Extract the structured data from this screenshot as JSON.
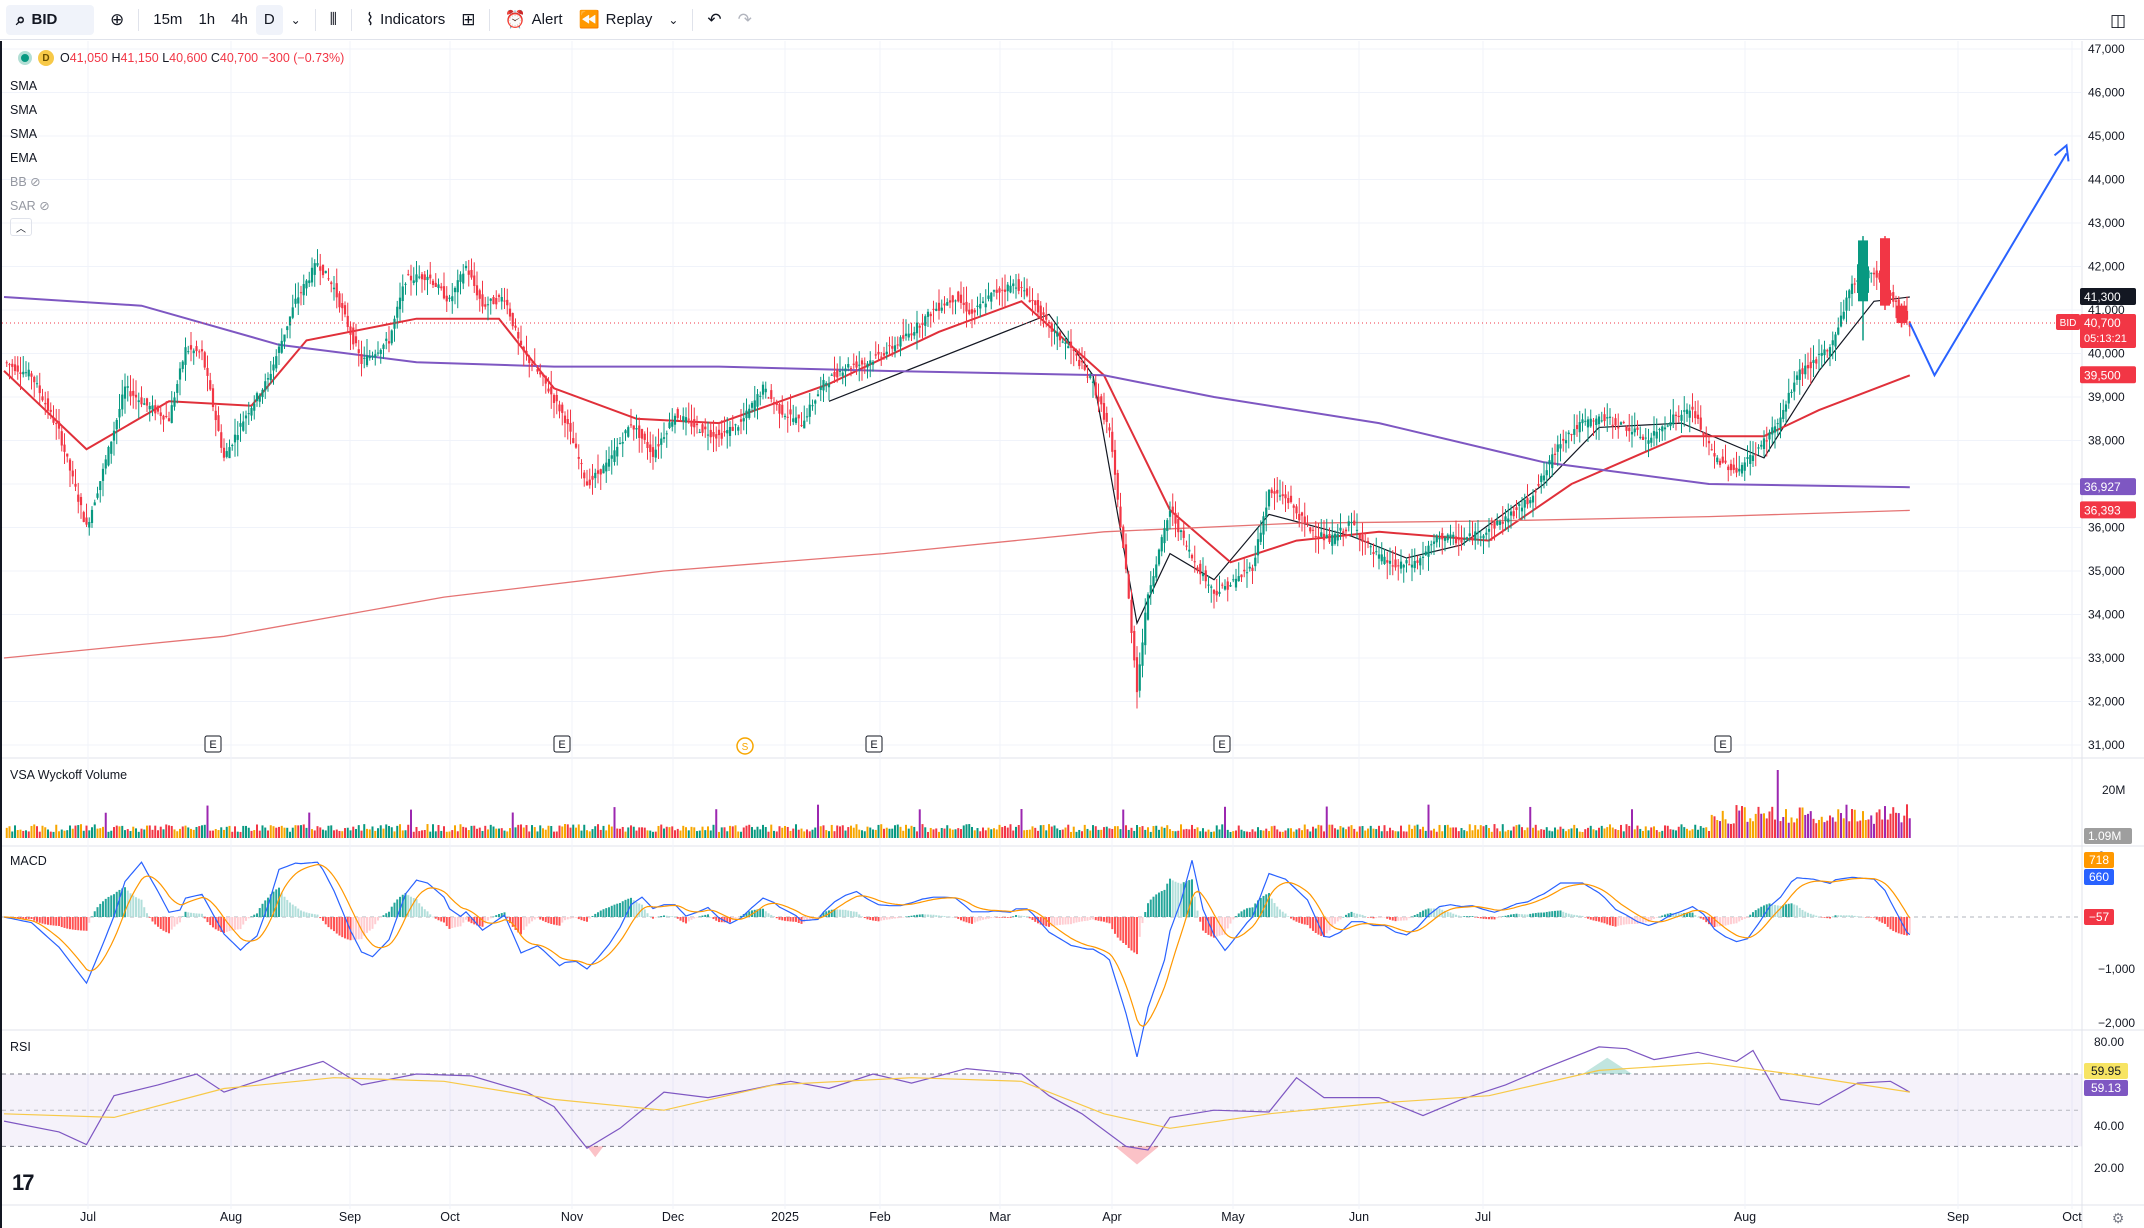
{
  "toolbar": {
    "symbol": "BID",
    "intervals": [
      "15m",
      "1h",
      "4h",
      "D"
    ],
    "active_interval": "D",
    "indicators_label": "Indicators",
    "alert_label": "Alert",
    "replay_label": "Replay"
  },
  "legend": {
    "interval_badge": "D",
    "o_label": "O",
    "o": "41,050",
    "h_label": "H",
    "h": "41,150",
    "l_label": "L",
    "l": "40,600",
    "c_label": "C",
    "c": "40,700",
    "change": "−300 (−0.73%)",
    "indicators": [
      "SMA",
      "SMA",
      "SMA",
      "EMA"
    ],
    "hidden_indicators": [
      "BB",
      "SAR"
    ]
  },
  "panes": {
    "volume_title": "VSA Wyckoff Volume",
    "macd_title": "MACD",
    "rsi_title": "RSI"
  },
  "colors": {
    "up": "#089981",
    "down": "#f23645",
    "ma_black": "#131722",
    "ma_red": "#e0303a",
    "ma_purple": "#7e57c2",
    "ma_long": "#e57373",
    "arrow": "#2962ff"
  },
  "chart_data": {
    "type": "candlestick",
    "symbol": "BID",
    "x_axis_labels": [
      "Jul",
      "Aug",
      "Sep",
      "Oct",
      "Nov",
      "Dec",
      "2025",
      "Feb",
      "Mar",
      "Apr",
      "May",
      "Jun",
      "Jul",
      "Aug",
      "Sep",
      "Oct"
    ],
    "price_axis": [
      "47,000",
      "46,000",
      "45,000",
      "44,000",
      "43,000",
      "42,000",
      "41,000",
      "40,000",
      "39,000",
      "38,000",
      "37,000",
      "36,000",
      "35,000",
      "34,000",
      "33,000",
      "32,000",
      "31,000"
    ],
    "ylim": [
      31000,
      47000
    ],
    "price_labels": [
      {
        "text": "41,300",
        "value": 41300,
        "color": "#131722"
      },
      {
        "text": "40,700",
        "value": 40700,
        "color": "#f23645",
        "tag": "BID",
        "countdown": "05:13:21"
      },
      {
        "text": "39,500",
        "value": 39500,
        "color": "#f23645"
      },
      {
        "text": "36,927",
        "value": 36927,
        "color": "#7e57c2"
      },
      {
        "text": "36,393",
        "value": 36393,
        "color": "#f23645"
      }
    ],
    "earnings_markers": [
      "E",
      "E",
      "E",
      "E",
      "E"
    ],
    "dividend_marker": "S",
    "close_path": [
      [
        0,
        39800
      ],
      [
        10,
        39500
      ],
      [
        20,
        38200
      ],
      [
        30,
        36000
      ],
      [
        36,
        37300
      ],
      [
        44,
        39200
      ],
      [
        52,
        38800
      ],
      [
        60,
        38500
      ],
      [
        66,
        40100
      ],
      [
        72,
        40000
      ],
      [
        80,
        37600
      ],
      [
        88,
        38600
      ],
      [
        96,
        39400
      ],
      [
        106,
        41200
      ],
      [
        114,
        42100
      ],
      [
        120,
        41500
      ],
      [
        130,
        39800
      ],
      [
        140,
        40300
      ],
      [
        146,
        41700
      ],
      [
        154,
        41800
      ],
      [
        162,
        41200
      ],
      [
        168,
        42000
      ],
      [
        174,
        41100
      ],
      [
        182,
        41300
      ],
      [
        188,
        40100
      ],
      [
        196,
        39400
      ],
      [
        204,
        38500
      ],
      [
        212,
        37000
      ],
      [
        220,
        37500
      ],
      [
        228,
        38400
      ],
      [
        236,
        37700
      ],
      [
        244,
        38600
      ],
      [
        252,
        38300
      ],
      [
        260,
        38100
      ],
      [
        268,
        38400
      ],
      [
        276,
        39200
      ],
      [
        282,
        38700
      ],
      [
        290,
        38400
      ],
      [
        298,
        39300
      ],
      [
        306,
        39700
      ],
      [
        314,
        39800
      ],
      [
        322,
        40100
      ],
      [
        330,
        40500
      ],
      [
        338,
        41000
      ],
      [
        346,
        41300
      ],
      [
        352,
        40900
      ],
      [
        360,
        41400
      ],
      [
        368,
        41600
      ],
      [
        374,
        41200
      ],
      [
        380,
        40600
      ],
      [
        388,
        40100
      ],
      [
        396,
        39300
      ],
      [
        402,
        38200
      ],
      [
        408,
        35000
      ],
      [
        412,
        32300
      ],
      [
        416,
        34500
      ],
      [
        424,
        36400
      ],
      [
        432,
        35300
      ],
      [
        440,
        34500
      ],
      [
        446,
        34700
      ],
      [
        454,
        35100
      ],
      [
        460,
        36800
      ],
      [
        466,
        36700
      ],
      [
        474,
        36000
      ],
      [
        482,
        35700
      ],
      [
        490,
        36100
      ],
      [
        498,
        35400
      ],
      [
        506,
        35100
      ],
      [
        514,
        35200
      ],
      [
        522,
        35800
      ],
      [
        530,
        35700
      ],
      [
        538,
        35900
      ],
      [
        546,
        36200
      ],
      [
        554,
        36600
      ],
      [
        560,
        37200
      ],
      [
        566,
        38000
      ],
      [
        574,
        38400
      ],
      [
        582,
        38500
      ],
      [
        590,
        38300
      ],
      [
        598,
        38000
      ],
      [
        606,
        38500
      ],
      [
        614,
        38700
      ],
      [
        622,
        37600
      ],
      [
        630,
        37300
      ],
      [
        638,
        37800
      ],
      [
        646,
        38500
      ],
      [
        652,
        39500
      ],
      [
        658,
        39800
      ],
      [
        664,
        40100
      ],
      [
        672,
        41600
      ],
      [
        680,
        41900
      ],
      [
        686,
        41300
      ],
      [
        693,
        40700
      ]
    ],
    "series": [
      {
        "name": "SMA",
        "color": "#131722",
        "points": [
          [
            300,
            38900
          ],
          [
            380,
            40900
          ],
          [
            396,
            39500
          ],
          [
            412,
            33800
          ],
          [
            424,
            35400
          ],
          [
            440,
            34800
          ],
          [
            460,
            36300
          ],
          [
            490,
            35800
          ],
          [
            510,
            35300
          ],
          [
            530,
            35600
          ],
          [
            560,
            37000
          ],
          [
            580,
            38300
          ],
          [
            610,
            38400
          ],
          [
            640,
            37600
          ],
          [
            660,
            39600
          ],
          [
            680,
            41200
          ],
          [
            693,
            41300
          ]
        ]
      },
      {
        "name": "SMA",
        "color": "#e0303a",
        "points": [
          [
            0,
            39600
          ],
          [
            30,
            37800
          ],
          [
            60,
            38900
          ],
          [
            90,
            38800
          ],
          [
            110,
            40300
          ],
          [
            150,
            40800
          ],
          [
            180,
            40800
          ],
          [
            200,
            39200
          ],
          [
            230,
            38500
          ],
          [
            260,
            38400
          ],
          [
            300,
            39300
          ],
          [
            340,
            40500
          ],
          [
            370,
            41200
          ],
          [
            400,
            39500
          ],
          [
            424,
            36400
          ],
          [
            446,
            35200
          ],
          [
            470,
            35700
          ],
          [
            500,
            35900
          ],
          [
            540,
            35700
          ],
          [
            570,
            37000
          ],
          [
            610,
            38100
          ],
          [
            640,
            38100
          ],
          [
            660,
            38700
          ],
          [
            693,
            39500
          ]
        ]
      },
      {
        "name": "SMA",
        "color": "#7e57c2",
        "points": [
          [
            0,
            41300
          ],
          [
            50,
            41100
          ],
          [
            100,
            40200
          ],
          [
            150,
            39800
          ],
          [
            200,
            39700
          ],
          [
            260,
            39700
          ],
          [
            320,
            39600
          ],
          [
            400,
            39500
          ],
          [
            440,
            39000
          ],
          [
            500,
            38400
          ],
          [
            560,
            37500
          ],
          [
            620,
            37000
          ],
          [
            693,
            36927
          ]
        ]
      },
      {
        "name": "EMA",
        "color": "#e57373",
        "points": [
          [
            0,
            33000
          ],
          [
            80,
            33500
          ],
          [
            160,
            34400
          ],
          [
            240,
            35000
          ],
          [
            320,
            35400
          ],
          [
            400,
            35900
          ],
          [
            470,
            36100
          ],
          [
            540,
            36150
          ],
          [
            620,
            36250
          ],
          [
            693,
            36393
          ]
        ]
      }
    ],
    "projection": [
      [
        693,
        40700
      ],
      [
        702,
        39500
      ],
      [
        750,
        44600
      ]
    ],
    "volume_axis": [
      "20M"
    ],
    "volume_last": "1.09M",
    "macd_axis": [
      "0",
      "−1,000",
      "−2,000"
    ],
    "macd_labels": [
      {
        "text": "718",
        "color": "#ff9800"
      },
      {
        "text": "660",
        "color": "#2962ff"
      },
      {
        "text": "−57",
        "color": "#f23645"
      }
    ],
    "rsi_axis": [
      "80.00",
      "40.00",
      "20.00"
    ],
    "rsi_labels": [
      {
        "text": "59.95",
        "color": "#f7e463"
      },
      {
        "text": "59.13",
        "color": "#7e57c2"
      }
    ],
    "rsi_path": [
      [
        0,
        44
      ],
      [
        20,
        38
      ],
      [
        30,
        31
      ],
      [
        40,
        58
      ],
      [
        56,
        64
      ],
      [
        70,
        70
      ],
      [
        80,
        60
      ],
      [
        100,
        70
      ],
      [
        116,
        77
      ],
      [
        130,
        64
      ],
      [
        150,
        70
      ],
      [
        170,
        69
      ],
      [
        190,
        60
      ],
      [
        200,
        52
      ],
      [
        212,
        29
      ],
      [
        224,
        40
      ],
      [
        240,
        60
      ],
      [
        256,
        57
      ],
      [
        270,
        61
      ],
      [
        286,
        66
      ],
      [
        300,
        62
      ],
      [
        316,
        70
      ],
      [
        330,
        65
      ],
      [
        350,
        73
      ],
      [
        370,
        70
      ],
      [
        380,
        58
      ],
      [
        392,
        48
      ],
      [
        408,
        30
      ],
      [
        416,
        28
      ],
      [
        424,
        46
      ],
      [
        440,
        50
      ],
      [
        460,
        49
      ],
      [
        470,
        68
      ],
      [
        480,
        57
      ],
      [
        500,
        57
      ],
      [
        516,
        47
      ],
      [
        530,
        56
      ],
      [
        546,
        64
      ],
      [
        560,
        73
      ],
      [
        580,
        85
      ],
      [
        590,
        84
      ],
      [
        600,
        78
      ],
      [
        616,
        82
      ],
      [
        630,
        77
      ],
      [
        636,
        83
      ],
      [
        646,
        56
      ],
      [
        660,
        53
      ],
      [
        674,
        65
      ],
      [
        686,
        66
      ],
      [
        693,
        60
      ]
    ],
    "rsi_ma_path": [
      [
        0,
        48
      ],
      [
        40,
        46
      ],
      [
        80,
        62
      ],
      [
        120,
        68
      ],
      [
        160,
        66
      ],
      [
        200,
        56
      ],
      [
        240,
        50
      ],
      [
        280,
        64
      ],
      [
        330,
        68
      ],
      [
        370,
        66
      ],
      [
        400,
        48
      ],
      [
        424,
        40
      ],
      [
        460,
        48
      ],
      [
        500,
        54
      ],
      [
        540,
        58
      ],
      [
        580,
        72
      ],
      [
        620,
        76
      ],
      [
        650,
        70
      ],
      [
        693,
        60
      ]
    ]
  }
}
